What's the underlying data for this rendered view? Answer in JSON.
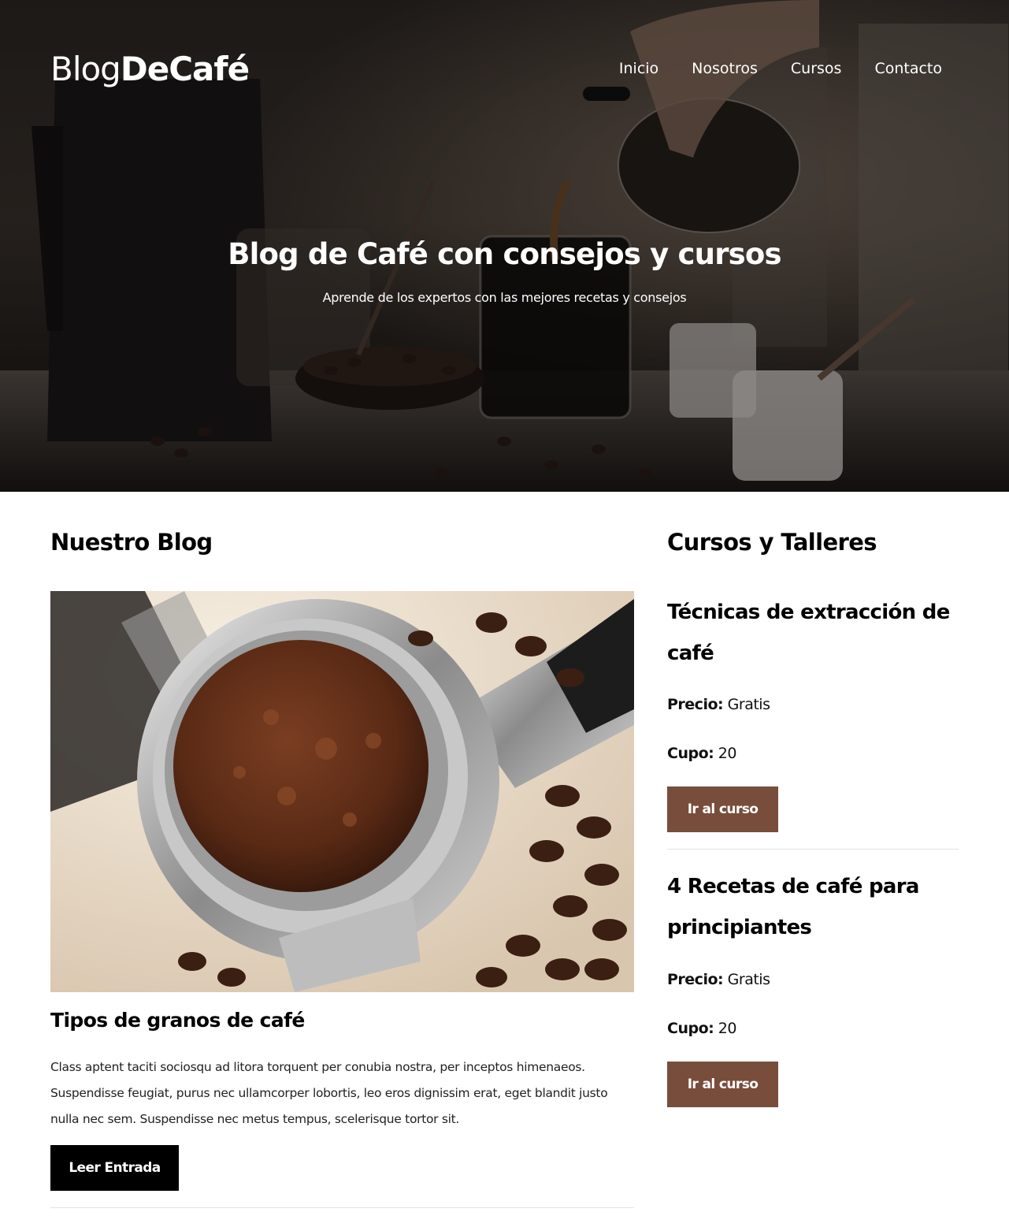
{
  "header": {
    "logo_light": "Blog",
    "logo_bold": "DeCafé",
    "nav": [
      "Inicio",
      "Nosotros",
      "Cursos",
      "Contacto"
    ]
  },
  "hero": {
    "title": "Blog de Café con consejos y cursos",
    "subtitle": "Aprende de los expertos con las mejores recetas y consejos"
  },
  "blog": {
    "heading": "Nuestro Blog",
    "post": {
      "title": "Tipos de granos de café",
      "text": "Class aptent taciti sociosqu ad litora torquent per conubia nostra, per inceptos himenaeos. Suspendisse feugiat, purus nec ullamcorper lobortis, leo eros dignissim erat, eget blandit justo nulla nec sem. Suspendisse nec metus tempus, scelerisque tortor sit.",
      "button": "Leer Entrada"
    }
  },
  "courses": {
    "heading": "Cursos y Talleres",
    "price_label": "Precio:",
    "quota_label": "Cupo:",
    "items": [
      {
        "title": "Técnicas de extracción de café",
        "price": "Gratis",
        "quota": "20",
        "button": "Ir al curso"
      },
      {
        "title": "4 Recetas de café para principiantes",
        "price": "Gratis",
        "quota": "20",
        "button": "Ir al curso"
      }
    ]
  },
  "colors": {
    "brand_brown": "#784d3c",
    "button_black": "#000000",
    "text": "#222222"
  }
}
